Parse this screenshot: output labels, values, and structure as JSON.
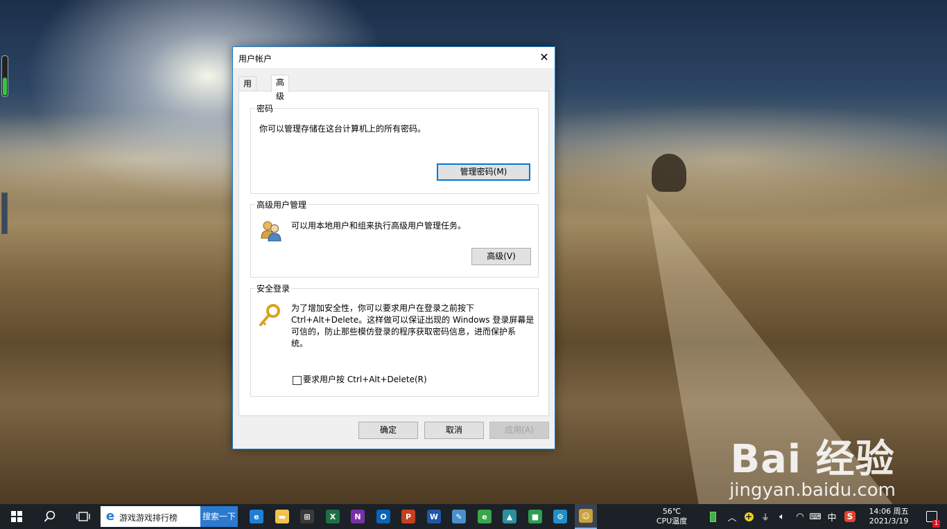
{
  "dialog": {
    "title": "用户帐户",
    "close_glyph": "✕",
    "tabs": [
      {
        "label": "用户",
        "active": false
      },
      {
        "label": "高级",
        "active": true
      }
    ],
    "password_group": {
      "label": "密码",
      "text": "你可以管理存储在这台计算机上的所有密码。",
      "button": "管理密码(M)"
    },
    "advanced_group": {
      "label": "高级用户管理",
      "icon": "users-icon",
      "text": "可以用本地用户和组来执行高级用户管理任务。",
      "button": "高级(V)"
    },
    "secure_group": {
      "label": "安全登录",
      "icon": "key-icon",
      "text_lines": [
        "为了增加安全性，你可以要求用户在登录之前按下",
        "Ctrl+Alt+Delete。这样做可以保证出现的 Windows 登录屏幕是",
        "可信的，防止那些模仿登录的程序获取密码信息，进而保护系",
        "统。"
      ],
      "checkbox_label": "要求用户按 Ctrl+Alt+Delete(R)",
      "checkbox_checked": false
    },
    "footer": {
      "ok": "确定",
      "cancel": "取消",
      "apply": "应用(A)"
    }
  },
  "watermark": {
    "logo": "Bai 经验",
    "url": "jingyan.baidu.com"
  },
  "taskbar": {
    "search_text": "游戏游戏排行榜",
    "search_button": "搜索一下",
    "cpu_temp": "56℃",
    "cpu_label": "CPU温度",
    "ime": "中",
    "time": "14:06 周五",
    "date": "2021/3/19",
    "notification_count": "1",
    "pinned_apps": [
      {
        "name": "edge-icon",
        "glyph": "e",
        "color": "#1f7fd8"
      },
      {
        "name": "file-explorer-icon",
        "glyph": "▬",
        "color": "#f2c14e"
      },
      {
        "name": "store-icon",
        "glyph": "⊞",
        "color": "#3a3a3a"
      },
      {
        "name": "excel-icon",
        "glyph": "X",
        "color": "#1d7044"
      },
      {
        "name": "onenote-icon",
        "glyph": "N",
        "color": "#7a2fa8"
      },
      {
        "name": "outlook-icon",
        "glyph": "O",
        "color": "#0a64b8"
      },
      {
        "name": "powerpoint-icon",
        "glyph": "P",
        "color": "#c4401f"
      },
      {
        "name": "word-icon",
        "glyph": "W",
        "color": "#1f57a8"
      },
      {
        "name": "paint-icon",
        "glyph": "✎",
        "color": "#4a8fcf"
      },
      {
        "name": "browser-360-icon",
        "glyph": "e",
        "color": "#3aa64a"
      },
      {
        "name": "photos-icon",
        "glyph": "▲",
        "color": "#2a8f9f"
      },
      {
        "name": "app-gallery-icon",
        "glyph": "■",
        "color": "#2e9e4f"
      },
      {
        "name": "settings-icon",
        "glyph": "⚙",
        "color": "#1e90c8"
      },
      {
        "name": "user-accounts-icon",
        "glyph": "☺",
        "color": "#c9a13a"
      }
    ]
  }
}
